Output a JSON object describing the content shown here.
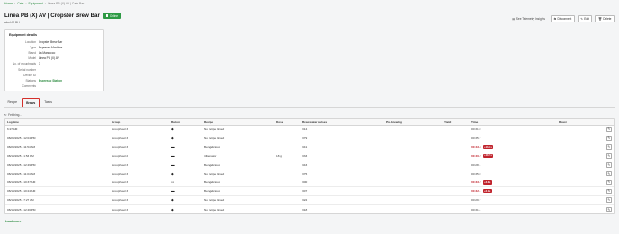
{
  "breadcrumb": [
    "Home",
    "Cafe",
    "Equipment",
    "Linea PB (X) AV | Cafe Bar"
  ],
  "title": "Linea PB (X) AV | Cropster Brew Bar",
  "status": "Online",
  "subtitle": "aka LM BH",
  "actions": {
    "telemetry": "See Telemetry Insights",
    "disconnect": "Disconnect",
    "edit": "Edit",
    "delete": "Delete"
  },
  "details": {
    "title": "Equipment details",
    "rows": [
      {
        "k": "Location",
        "v": "Cropster Brew Bar"
      },
      {
        "k": "Type",
        "v": "Espresso Machine"
      },
      {
        "k": "Brand",
        "v": "La Marzocco"
      },
      {
        "k": "Model",
        "v": "Linea PB (X) AV"
      },
      {
        "k": "No. of groupheads",
        "v": "3"
      },
      {
        "k": "Serial number",
        "v": ""
      },
      {
        "k": "Device ID",
        "v": ""
      },
      {
        "k": "Stations",
        "v": "Espresso Station"
      },
      {
        "k": "Comments",
        "v": ""
      }
    ]
  },
  "tabs": [
    "Recipe",
    "Brews",
    "Tasks"
  ],
  "fetching": "Fetching...",
  "columns": [
    "Log time",
    "Group",
    "Button",
    "Recipe",
    "Dose",
    "Brew water pulses",
    "Pre-brewing",
    "Yield",
    "Time",
    "Roast"
  ],
  "rows": [
    {
      "log": "6:27 AM",
      "group": "Grouphead 3",
      "btn": "◆",
      "recipe": "No recipe linked",
      "dose": "",
      "pulses": "314",
      "time": "00:31.0",
      "red": false,
      "badge": ""
    },
    {
      "log": "08/20/2025 - 12:04 PM",
      "group": "Grouphead 3",
      "btn": "◆",
      "recipe": "No recipe linked",
      "dose": "",
      "pulses": "379",
      "time": "00:35.7",
      "red": false,
      "badge": ""
    },
    {
      "log": "08/20/2025 - 11:54 AM",
      "group": "Grouphead 3",
      "btn": "▬",
      "recipe": "Bengalicious",
      "dose": "",
      "pulses": "341",
      "time": "00:43.4",
      "red": true,
      "badge": "+13.4 s"
    },
    {
      "log": "08/19/2025 - 1:53 PM",
      "group": "Grouphead 2",
      "btn": "▬",
      "recipe": "rilliemator",
      "dose": "18 g",
      "pulses": "333",
      "time": "00:40.2",
      "red": true,
      "badge": "+10.2 s"
    },
    {
      "log": "08/19/2025 - 12:49 PM",
      "group": "Grouphead 3",
      "btn": "▬",
      "recipe": "Bengalicious",
      "dose": "",
      "pulses": "343",
      "time": "00:28.1",
      "red": false,
      "badge": ""
    },
    {
      "log": "08/19/2025 - 11:04 AM",
      "group": "Grouphead 3",
      "btn": "◆",
      "recipe": "No recipe linked",
      "dose": "",
      "pulses": "375",
      "time": "00:35.0",
      "red": false,
      "badge": ""
    },
    {
      "log": "08/19/2025 - 10:37 AM",
      "group": "Grouphead 3",
      "btn": "▭",
      "recipe": "Bengalicious",
      "dose": "",
      "pulses": "300",
      "time": "00:33.2",
      "red": true,
      "badge": "+3.2 s"
    },
    {
      "log": "08/19/2025 - 10:24 AM",
      "group": "Grouphead 3",
      "btn": "▬",
      "recipe": "Bengalicious",
      "dose": "",
      "pulses": "307",
      "time": "00:32.1",
      "red": true,
      "badge": "+2.1 s"
    },
    {
      "log": "08/19/2025 - 7:27 AM",
      "group": "Grouphead 3",
      "btn": "◆",
      "recipe": "No recipe linked",
      "dose": "",
      "pulses": "322",
      "time": "00:29.7",
      "red": false,
      "badge": ""
    },
    {
      "log": "08/19/2025 - 12:46 PM",
      "group": "Grouphead 3",
      "btn": "◆",
      "recipe": "No recipe linked",
      "dose": "",
      "pulses": "318",
      "time": "00:31.4",
      "red": false,
      "badge": ""
    }
  ],
  "load_more": "Load more",
  "colors": {
    "accent": "#2a8a3e",
    "online": "#2e9a45",
    "alert": "#c0232c",
    "tab_highlight": "#d4302b"
  }
}
